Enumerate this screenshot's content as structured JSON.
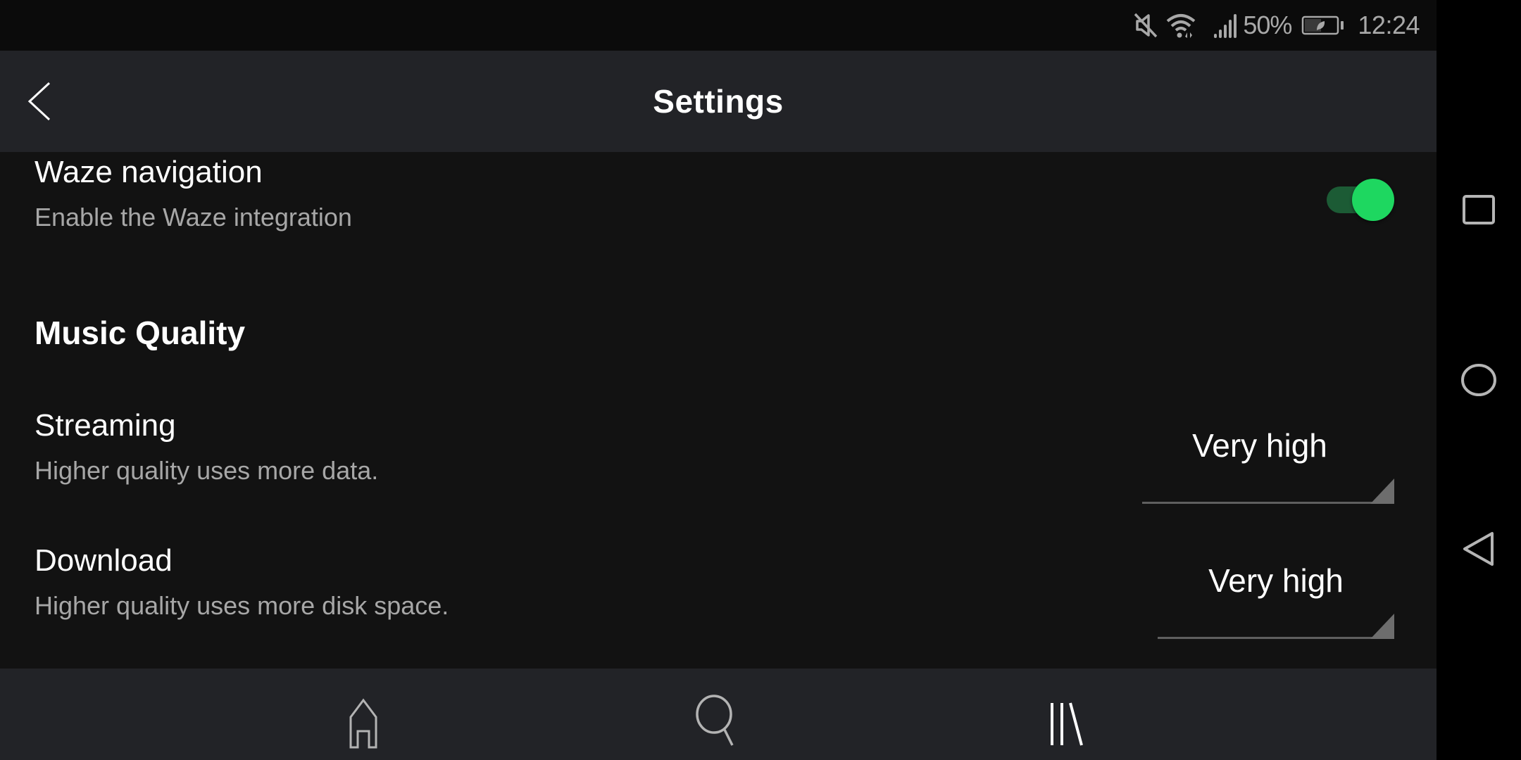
{
  "status_bar": {
    "icons": [
      "mute-icon",
      "wifi-icon",
      "signal-icon",
      "battery-saver-icon"
    ],
    "battery_percent": "50%",
    "time": "12:24"
  },
  "header": {
    "back_icon": "chevron-left-icon",
    "title": "Settings"
  },
  "settings": {
    "waze": {
      "title": "Waze navigation",
      "subtitle": "Enable the Waze integration",
      "enabled": true
    },
    "music_quality": {
      "heading": "Music Quality",
      "streaming": {
        "title": "Streaming",
        "subtitle": "Higher quality uses more data.",
        "value": "Very high"
      },
      "download": {
        "title": "Download",
        "subtitle": "Higher quality uses more disk space.",
        "value": "Very high"
      }
    }
  },
  "bottom_nav": {
    "items": [
      {
        "icon": "home-icon",
        "active": false
      },
      {
        "icon": "search-icon",
        "active": false
      },
      {
        "icon": "library-icon",
        "active": true
      }
    ]
  },
  "system_nav": {
    "buttons": [
      "recents-icon",
      "home-circle-icon",
      "back-triangle-icon"
    ]
  },
  "colors": {
    "accent": "#1ed760",
    "toggle_track": "#1c5b35",
    "background": "#121212",
    "header_bg": "#222327"
  }
}
